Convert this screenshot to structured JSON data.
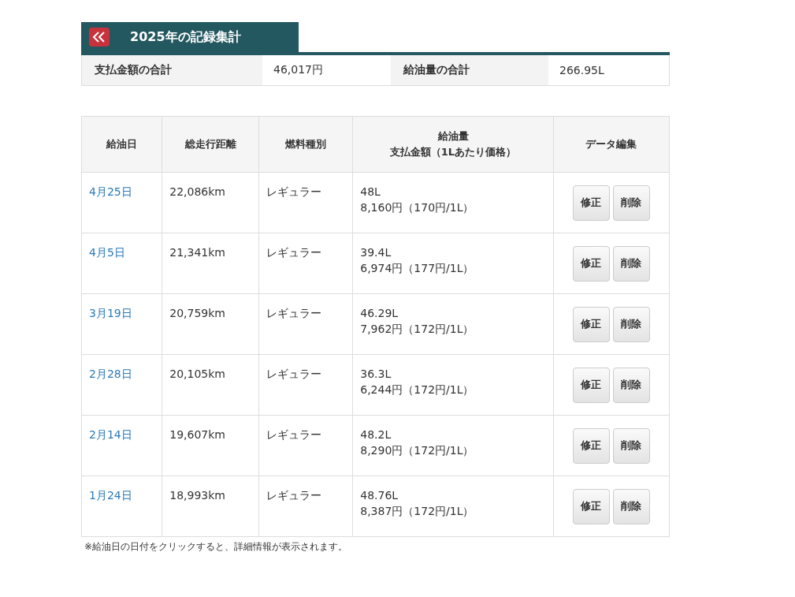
{
  "heading": {
    "title": "2025年の記録集計"
  },
  "summary": [
    {
      "label": "支払金額の合計",
      "value": "46,017円"
    },
    {
      "label": "給油量の合計",
      "value": "266.95L"
    }
  ],
  "table": {
    "columns": [
      {
        "lines": [
          "給油日"
        ]
      },
      {
        "lines": [
          "総走行距離"
        ]
      },
      {
        "lines": [
          "燃料種別"
        ]
      },
      {
        "lines": [
          "給油量",
          "支払金額（1Lあたり価格）"
        ]
      },
      {
        "lines": [
          "データ編集"
        ]
      }
    ],
    "rows": [
      {
        "date": "4月25日",
        "distance": "22,086km",
        "fuel": "レギュラー",
        "volume": "48L",
        "payment": "8,160円（170円/1L）",
        "actions": [
          "修正",
          "削除"
        ]
      },
      {
        "date": "4月5日",
        "distance": "21,341km",
        "fuel": "レギュラー",
        "volume": "39.4L",
        "payment": "6,974円（177円/1L）",
        "actions": [
          "修正",
          "削除"
        ]
      },
      {
        "date": "3月19日",
        "distance": "20,759km",
        "fuel": "レギュラー",
        "volume": "46.29L",
        "payment": "7,962円（172円/1L）",
        "actions": [
          "修正",
          "削除"
        ]
      },
      {
        "date": "2月28日",
        "distance": "20,105km",
        "fuel": "レギュラー",
        "volume": "36.3L",
        "payment": "6,244円（172円/1L）",
        "actions": [
          "修正",
          "削除"
        ]
      },
      {
        "date": "2月14日",
        "distance": "19,607km",
        "fuel": "レギュラー",
        "volume": "48.2L",
        "payment": "8,290円（172円/1L）",
        "actions": [
          "修正",
          "削除"
        ]
      },
      {
        "date": "1月24日",
        "distance": "18,993km",
        "fuel": "レギュラー",
        "volume": "48.76L",
        "payment": "8,387円（172円/1L）",
        "actions": [
          "修正",
          "削除"
        ]
      }
    ]
  },
  "note": "※給油日の日付をクリックすると、詳細情報が表示されます。"
}
